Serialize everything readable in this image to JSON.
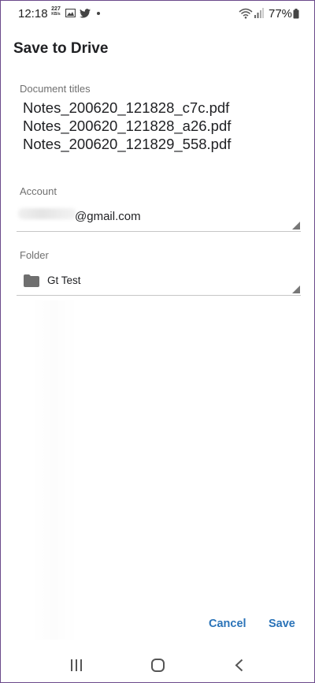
{
  "status_bar": {
    "time": "12:18",
    "data_rate_value": "227",
    "data_rate_unit": "KB/s",
    "battery": "77%",
    "icons": [
      "image-icon",
      "twitter-icon",
      "wifi-icon",
      "signal-icon",
      "battery-icon"
    ]
  },
  "dialog": {
    "title": "Save to Drive",
    "document_titles_label": "Document titles",
    "document_titles": [
      "Notes_200620_121828_c7c.pdf",
      "Notes_200620_121828_a26.pdf",
      "Notes_200620_121829_558.pdf"
    ],
    "account_label": "Account",
    "account_value": "@gmail.com",
    "folder_label": "Folder",
    "folder_value": "Gt Test"
  },
  "actions": {
    "cancel_label": "Cancel",
    "save_label": "Save"
  },
  "nav_bar": {
    "icons": [
      "recent-apps-icon",
      "home-icon",
      "back-icon"
    ]
  },
  "colors": {
    "accent": "#2a73b8",
    "label": "#707070",
    "text": "#202124"
  }
}
